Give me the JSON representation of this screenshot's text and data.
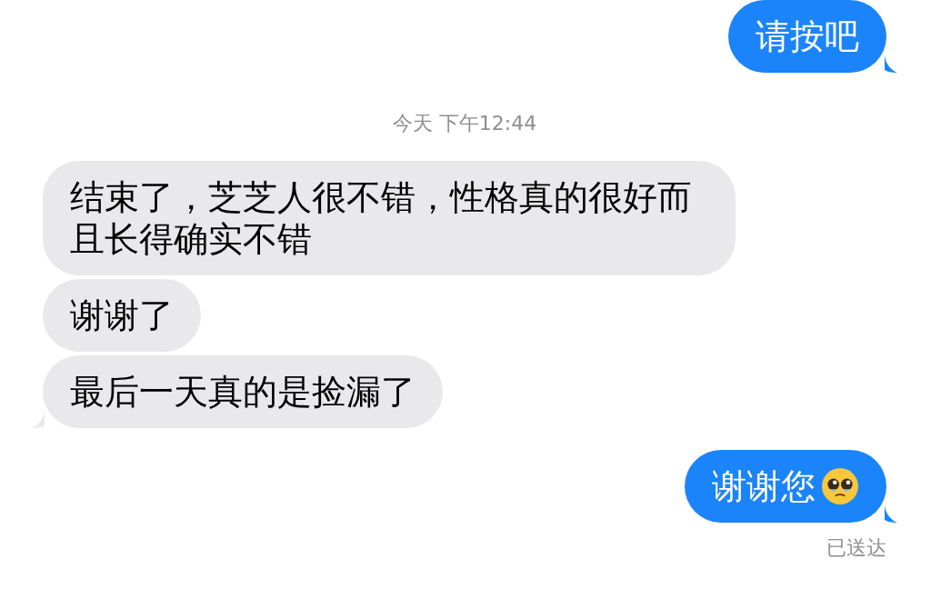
{
  "messages": [
    {
      "kind": "sent",
      "text": "请按吧",
      "tail": true,
      "emoji": false
    },
    {
      "kind": "timestamp",
      "text": "今天 下午12:44"
    },
    {
      "kind": "received",
      "text": "结束了，芝芝人很不错，性格真的很好而且长得确实不错",
      "tail": false,
      "emoji": false
    },
    {
      "kind": "received",
      "text": "谢谢了",
      "tail": false,
      "emoji": false
    },
    {
      "kind": "received",
      "text": "最后一天真的是捡漏了",
      "tail": true,
      "emoji": false
    },
    {
      "kind": "sent",
      "text": "谢谢您",
      "tail": true,
      "emoji": true
    },
    {
      "kind": "status",
      "text": "已送达"
    }
  ]
}
